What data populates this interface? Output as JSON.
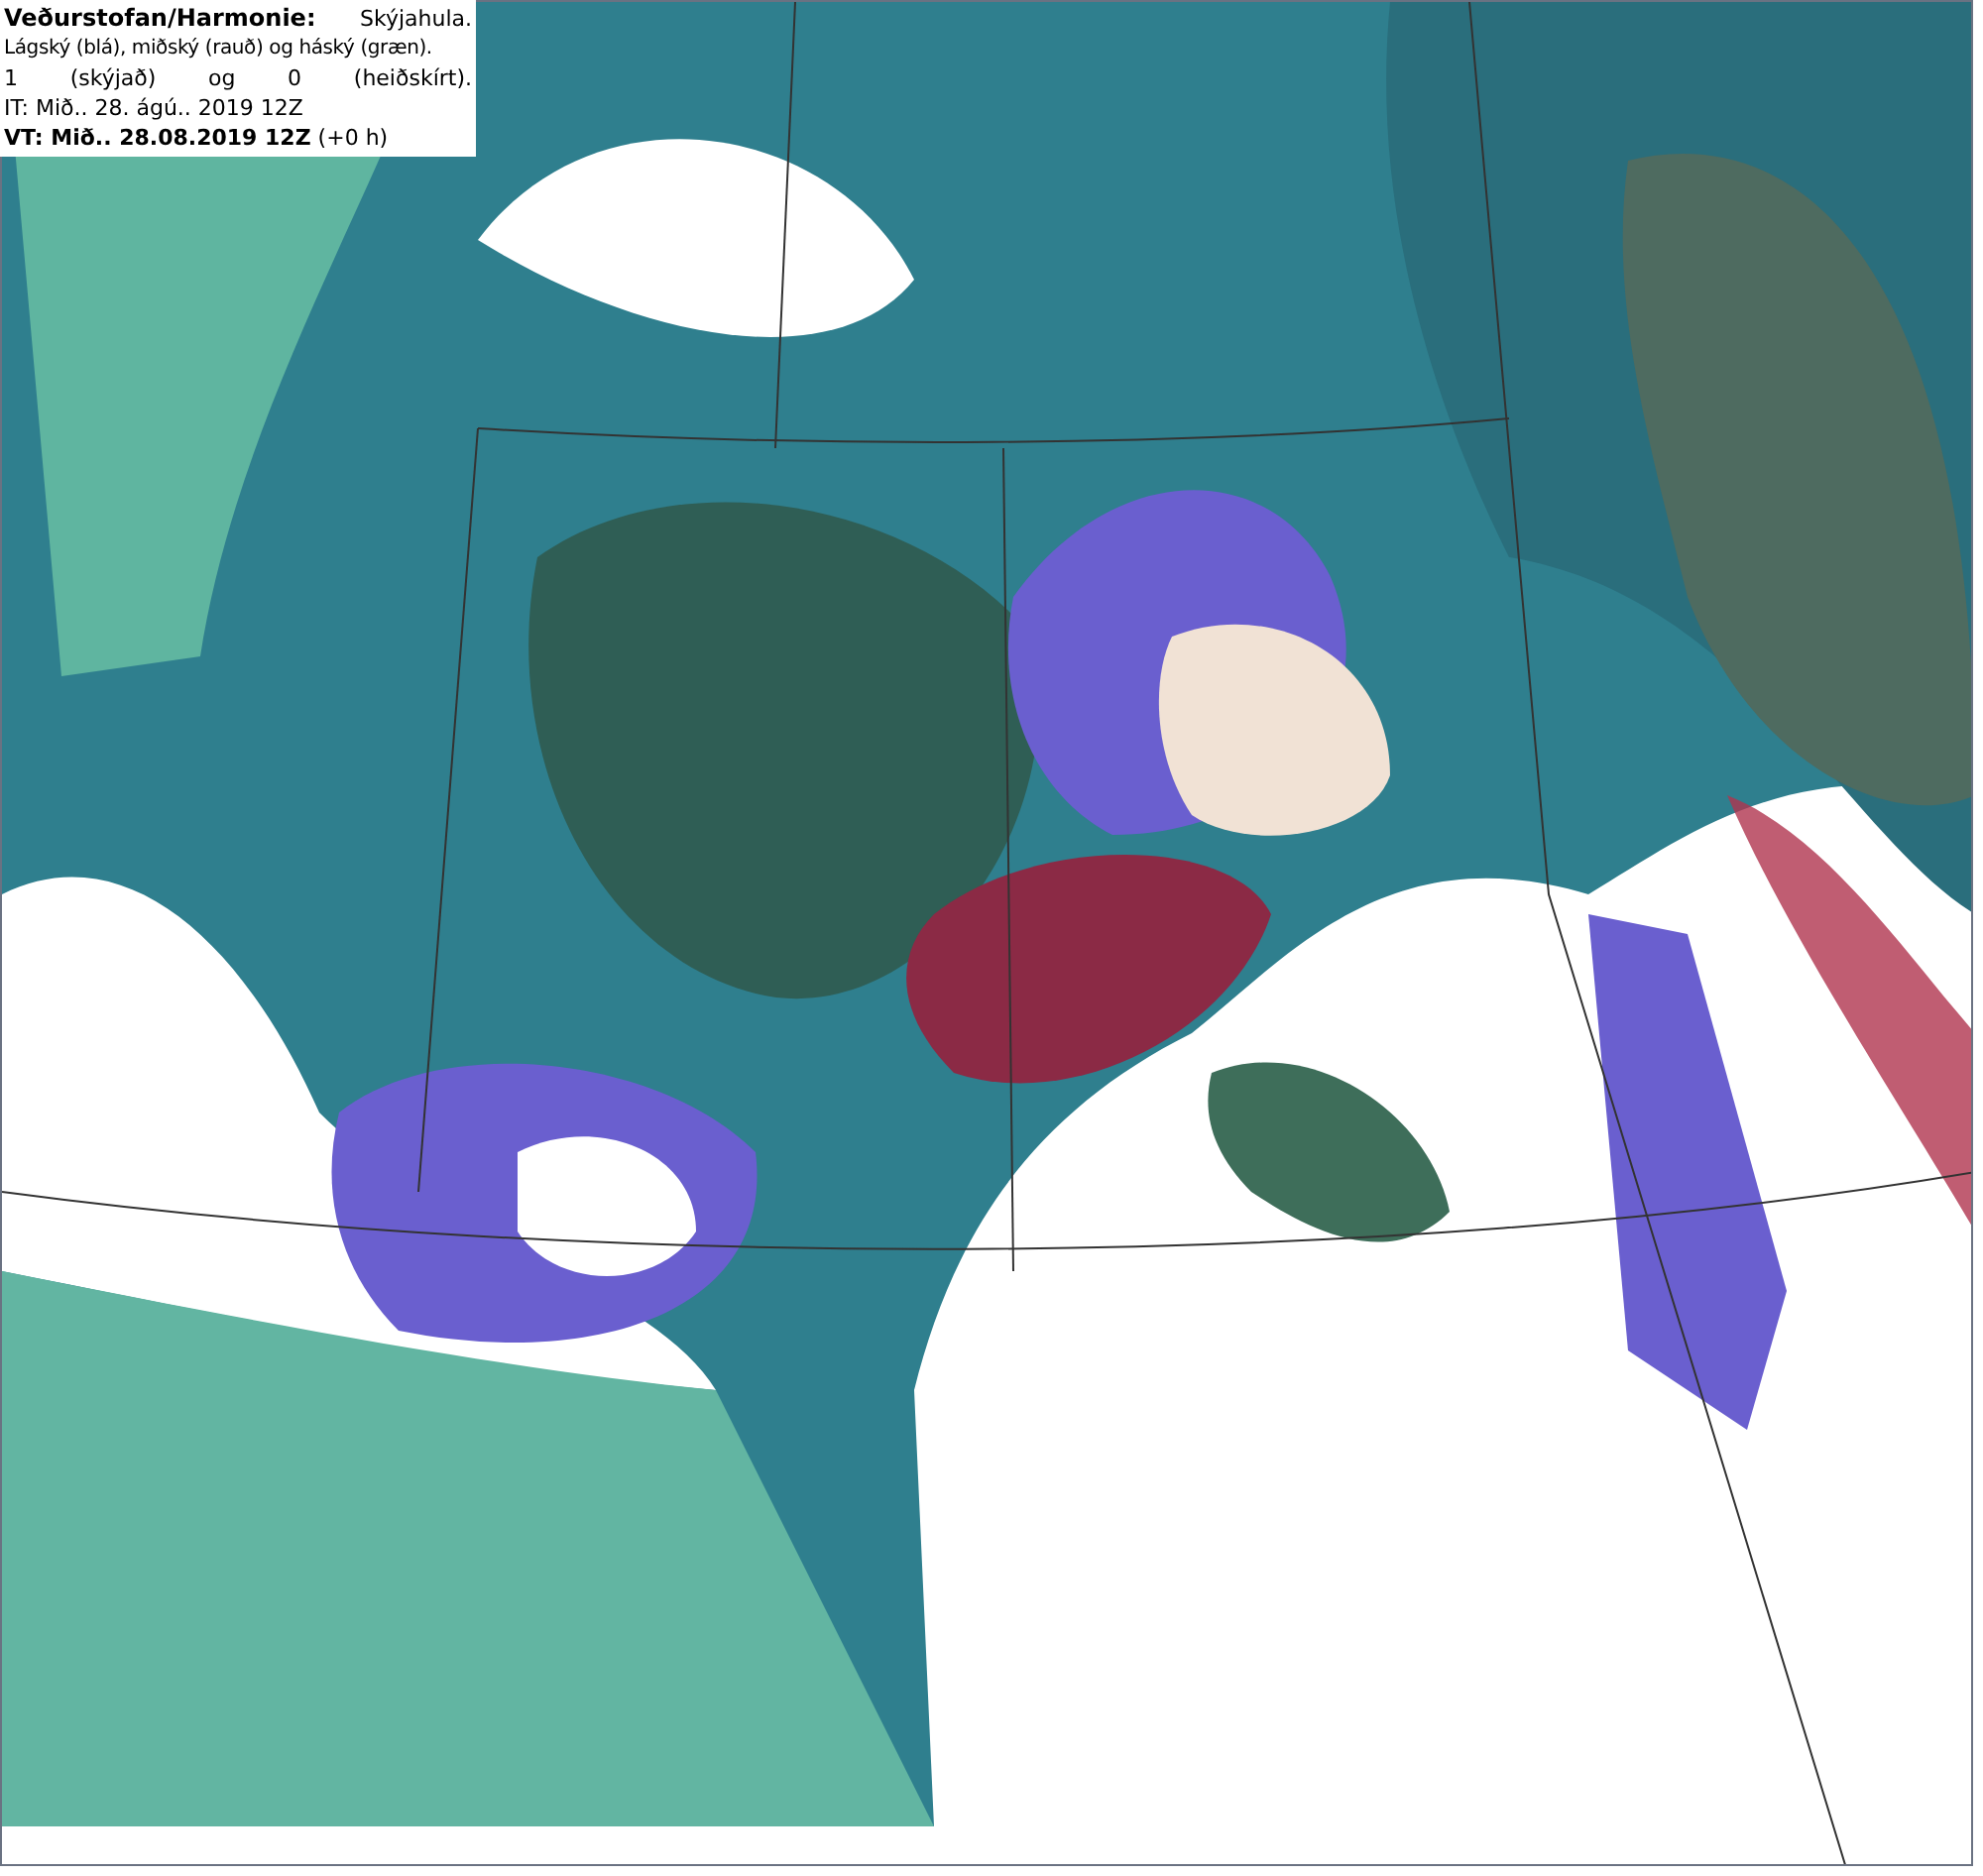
{
  "legend": {
    "source": "Veðurstofan/Harmonie:",
    "product": "Skýjahula.",
    "description": "Lágský (blá), miðský (rauð) og háský (græn).",
    "scale": "1 (skýjað) og 0 (heiðskírt).",
    "issue_time": "IT: Mið.. 28. ágú.. 2019 12Z",
    "valid_time": "**VT: Mið.. 28.08.2019 12Z** (+0 h)"
  }
}
